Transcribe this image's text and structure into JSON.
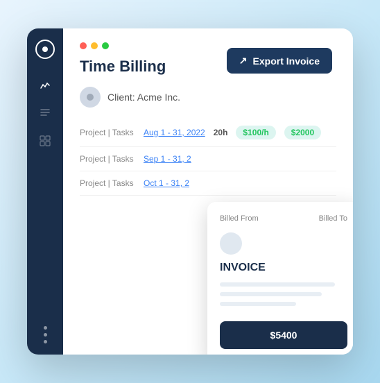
{
  "export_button": {
    "label": "Export Invoice",
    "icon": "export-icon"
  },
  "window": {
    "titlebar": {
      "dots": [
        "red",
        "yellow",
        "green"
      ]
    }
  },
  "sidebar": {
    "logo_icon": "circle-logo-icon",
    "icons": [
      {
        "name": "chart-icon",
        "active": true
      },
      {
        "name": "list-icon",
        "active": false
      },
      {
        "name": "grid-icon",
        "active": false
      }
    ],
    "dots": [
      "dot1",
      "dot2",
      "dot3"
    ]
  },
  "page": {
    "title": "Time Billing",
    "client_label": "Client: Acme Inc."
  },
  "billing_rows": [
    {
      "label": "Project | Tasks",
      "date": "Aug 1 - 31, 2022",
      "hours": "20h",
      "rate": "$100/h",
      "total": "$2000"
    },
    {
      "label": "Project | Tasks",
      "date": "Sep 1 - 31, 2",
      "hours": "",
      "rate": "",
      "total": ""
    },
    {
      "label": "Project | Tasks",
      "date": "Oct 1 - 31, 2",
      "hours": "",
      "rate": "",
      "total": ""
    }
  ],
  "invoice_popup": {
    "billed_from_label": "Billed From",
    "billed_to_label": "Billed To",
    "title": "INVOICE",
    "total_label": "$5400"
  }
}
